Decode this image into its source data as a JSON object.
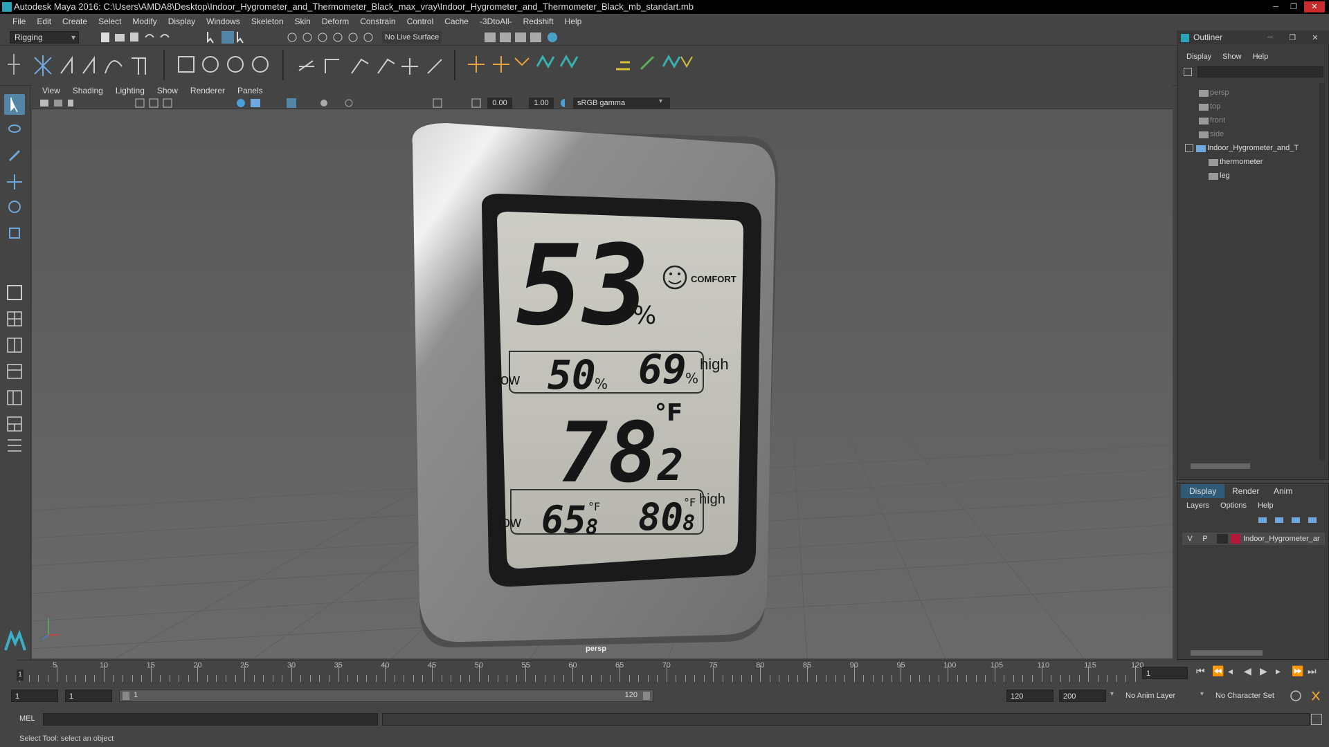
{
  "window": {
    "title": "Autodesk Maya 2016: C:\\Users\\AMDA8\\Desktop\\Indoor_Hygrometer_and_Thermometer_Black_max_vray\\Indoor_Hygrometer_and_Thermometer_Black_mb_standart.mb",
    "min": "─",
    "max": "❐",
    "close": "✕"
  },
  "menubar": [
    "File",
    "Edit",
    "Create",
    "Select",
    "Modify",
    "Display",
    "Windows",
    "Skeleton",
    "Skin",
    "Deform",
    "Constrain",
    "Control",
    "Cache",
    "-3DtoAll-",
    "Redshift",
    "Help"
  ],
  "statusline": {
    "mode": "Rigging",
    "live_surface": "No Live Surface"
  },
  "viewport": {
    "menu": [
      "View",
      "Shading",
      "Lighting",
      "Show",
      "Renderer",
      "Panels"
    ],
    "exposure": "0.00",
    "gamma": "1.00",
    "colorspace": "sRGB gamma",
    "camera": "persp"
  },
  "device": {
    "humidity": "53",
    "humidity_unit": "%",
    "comfort": "COMFORT",
    "hum_low_label": "low",
    "hum_low": "50",
    "hum_high": "69",
    "hum_high_label": "high",
    "temp": "78",
    "temp_decimal": "2",
    "temp_unit": "°F",
    "temp_low_label": "low",
    "temp_low": "65",
    "temp_low_dec": "8",
    "temp_high": "80",
    "temp_high_dec": "8",
    "temp_high_label": "high",
    "small_unit_f": "°F",
    "small_pct": "%"
  },
  "outliner": {
    "title": "Outliner",
    "menu": [
      "Display",
      "Show",
      "Help"
    ],
    "items": [
      {
        "label": "persp",
        "dim": true
      },
      {
        "label": "top",
        "dim": true
      },
      {
        "label": "front",
        "dim": true
      },
      {
        "label": "side",
        "dim": true
      },
      {
        "label": "Indoor_Hygrometer_and_T",
        "dim": false
      },
      {
        "label": "thermometer",
        "dim": false
      },
      {
        "label": "leg",
        "dim": false
      }
    ]
  },
  "layers": {
    "tabs": [
      "Display",
      "Render",
      "Anim"
    ],
    "menu": [
      "Layers",
      "Options",
      "Help"
    ],
    "row": {
      "v": "V",
      "p": "P",
      "name": "Indoor_Hygrometer_ar",
      "color": "#b3173a"
    }
  },
  "timeline": {
    "ticks": [
      "5",
      "10",
      "15",
      "20",
      "25",
      "30",
      "35",
      "40",
      "45",
      "50",
      "55",
      "60",
      "65",
      "70",
      "75",
      "80",
      "85",
      "90",
      "95",
      "100",
      "105",
      "110",
      "115",
      "120"
    ],
    "current_frame": "1",
    "current_marker": "1"
  },
  "range": {
    "start": "1",
    "start_inner": "1",
    "slider_start": "1",
    "slider_end": "120",
    "end_inner": "120",
    "end": "200",
    "anim_layer": "No Anim Layer",
    "char_set": "No Character Set"
  },
  "cmdline": {
    "label": "MEL"
  },
  "helpline": {
    "text": "Select Tool: select an object"
  }
}
